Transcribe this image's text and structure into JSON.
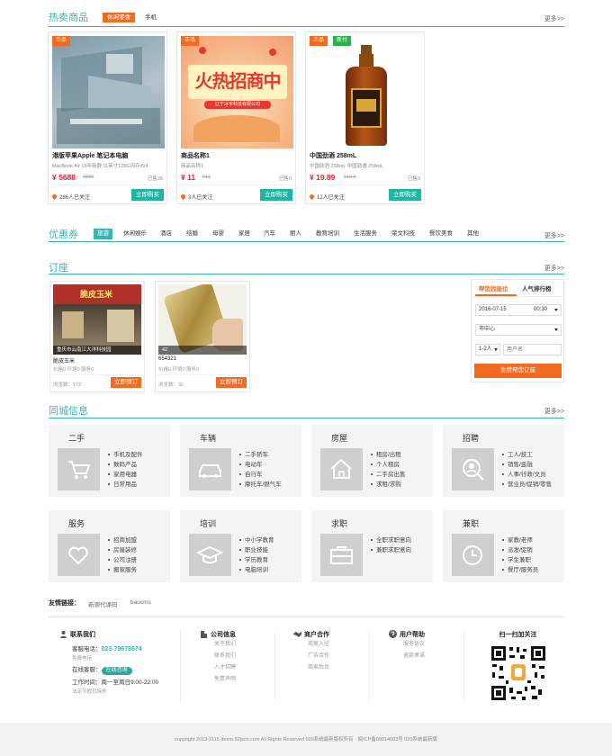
{
  "hot": {
    "title": "热卖商品",
    "tabs": [
      "休闲零食",
      "手机"
    ],
    "more": "更多>>",
    "products": [
      {
        "badge": "正品",
        "name": "港版苹果Apple 笔记本电脑",
        "desc": "MacBook Air 15年新款 11英寸128G闪存i5/4",
        "price": "¥ 5688",
        "old": "6888",
        "sold": "已售25",
        "follow": "286人已关注",
        "buy": "立即购买"
      },
      {
        "badge": "正品",
        "name": "商品名称1",
        "desc": "商品名称1",
        "price": "¥ 11",
        "old": "611",
        "sold": "已售0",
        "follow": "3人已关注",
        "buy": "立即购买",
        "poster": {
          "title": "火热招商中",
          "company": "辽宁冰宇科技有限公司"
        }
      },
      {
        "badge": "正品",
        "badge2": "新付",
        "name": "中国劲酒 258mL",
        "desc": "中国劲酒 258mL 中国劲酒 258mL",
        "price": "¥ 19.89",
        "old": "619.9",
        "sold": "已售0",
        "follow": "12人已关注",
        "buy": "立即购买"
      }
    ]
  },
  "coupons": {
    "title": "优惠券",
    "more": "更多>>",
    "tabs": [
      "旅游",
      "休闲娱乐",
      "酒店",
      "结婚",
      "母婴",
      "家居",
      "汽车",
      "丽人",
      "教育培训",
      "生活服务",
      "荣文科技",
      "餐饮美食",
      "其他"
    ]
  },
  "booking": {
    "title": "订座",
    "more": "更多>>",
    "items": [
      {
        "caption": "重庆市云南江大洋科技园",
        "name": "脆皮玉米",
        "meta": "价格0   环境0   服务0",
        "views": "浏览数：172",
        "button": "立即预订",
        "sign": "脆皮玉米"
      },
      {
        "caption": "42",
        "name": "654321",
        "meta": "价格0   环境0   服务0",
        "views": "浏览数：32",
        "button": "立即预订"
      }
    ],
    "panel": {
      "tab1": "帮您找座位",
      "tab2": "人气排行榜",
      "date": "2016-07-15",
      "time": "00:30",
      "area": "市中心",
      "people": "1-2人",
      "name_placeholder": "用户名",
      "submit": "免费帮您订座"
    }
  },
  "local": {
    "title": "同城信息",
    "more": "更多>>",
    "boxes": [
      {
        "title": "二手",
        "items": [
          "手机及配件",
          "数码产品",
          "家用电器",
          "日常用品"
        ]
      },
      {
        "title": "车辆",
        "items": [
          "二手轿车",
          "电动车",
          "自行车",
          "摩托车/燃气车"
        ]
      },
      {
        "title": "房屋",
        "items": [
          "租房/出租",
          "个人租房",
          "二手房出售",
          "求租/求购"
        ]
      },
      {
        "title": "招聘",
        "items": [
          "工人/技工",
          "销售/金融",
          "人事/行政/文员",
          "营业员/促销/零售"
        ]
      },
      {
        "title": "服务",
        "items": [
          "招商加盟",
          "房屋装修",
          "公司注册",
          "搬家服务"
        ]
      },
      {
        "title": "培训",
        "items": [
          "中小学教育",
          "职业技能",
          "学历教育",
          "电脑培训"
        ]
      },
      {
        "title": "求职",
        "items": [
          "全职求职意向",
          "兼职求职意向"
        ]
      },
      {
        "title": "兼职",
        "items": [
          "家教/老师",
          "派发/促销",
          "学生兼职",
          "餐厅/服务员"
        ]
      }
    ]
  },
  "friends": {
    "label": "友情链接：",
    "links": [
      "新源代课码",
      "baocms"
    ]
  },
  "footer": {
    "contact": {
      "title": "联系我们",
      "hotline_label": "客服电话：",
      "hotline": "023-79678674",
      "free": "免费电话",
      "online_label": "在线客服：",
      "online_btn": "在线咨询",
      "hours": "工作时间：周一至周日9:00-22:00",
      "holiday": "法定节假日除外"
    },
    "company": {
      "title": "公司信息",
      "links": [
        "关于我们",
        "联系我们",
        "人才招聘",
        "免责声明"
      ]
    },
    "partner": {
      "title": "商户合作",
      "links": [
        "商家入驻",
        "广告合作",
        "商家后台"
      ]
    },
    "help": {
      "title": "用户帮助",
      "links": [
        "服务协议",
        "退款承诺"
      ]
    },
    "qr": {
      "title": "扫一扫加关注"
    },
    "copyright": "copyright 2013-2115 demo.52jscn.com All Rights Reserved 020系统最新版权所有 · 皖ICP备09014003号 020系统最新版"
  },
  "colors": {
    "accent": "#3ab3b6",
    "orange": "#f26b21",
    "buy": "#1fb5a3"
  }
}
